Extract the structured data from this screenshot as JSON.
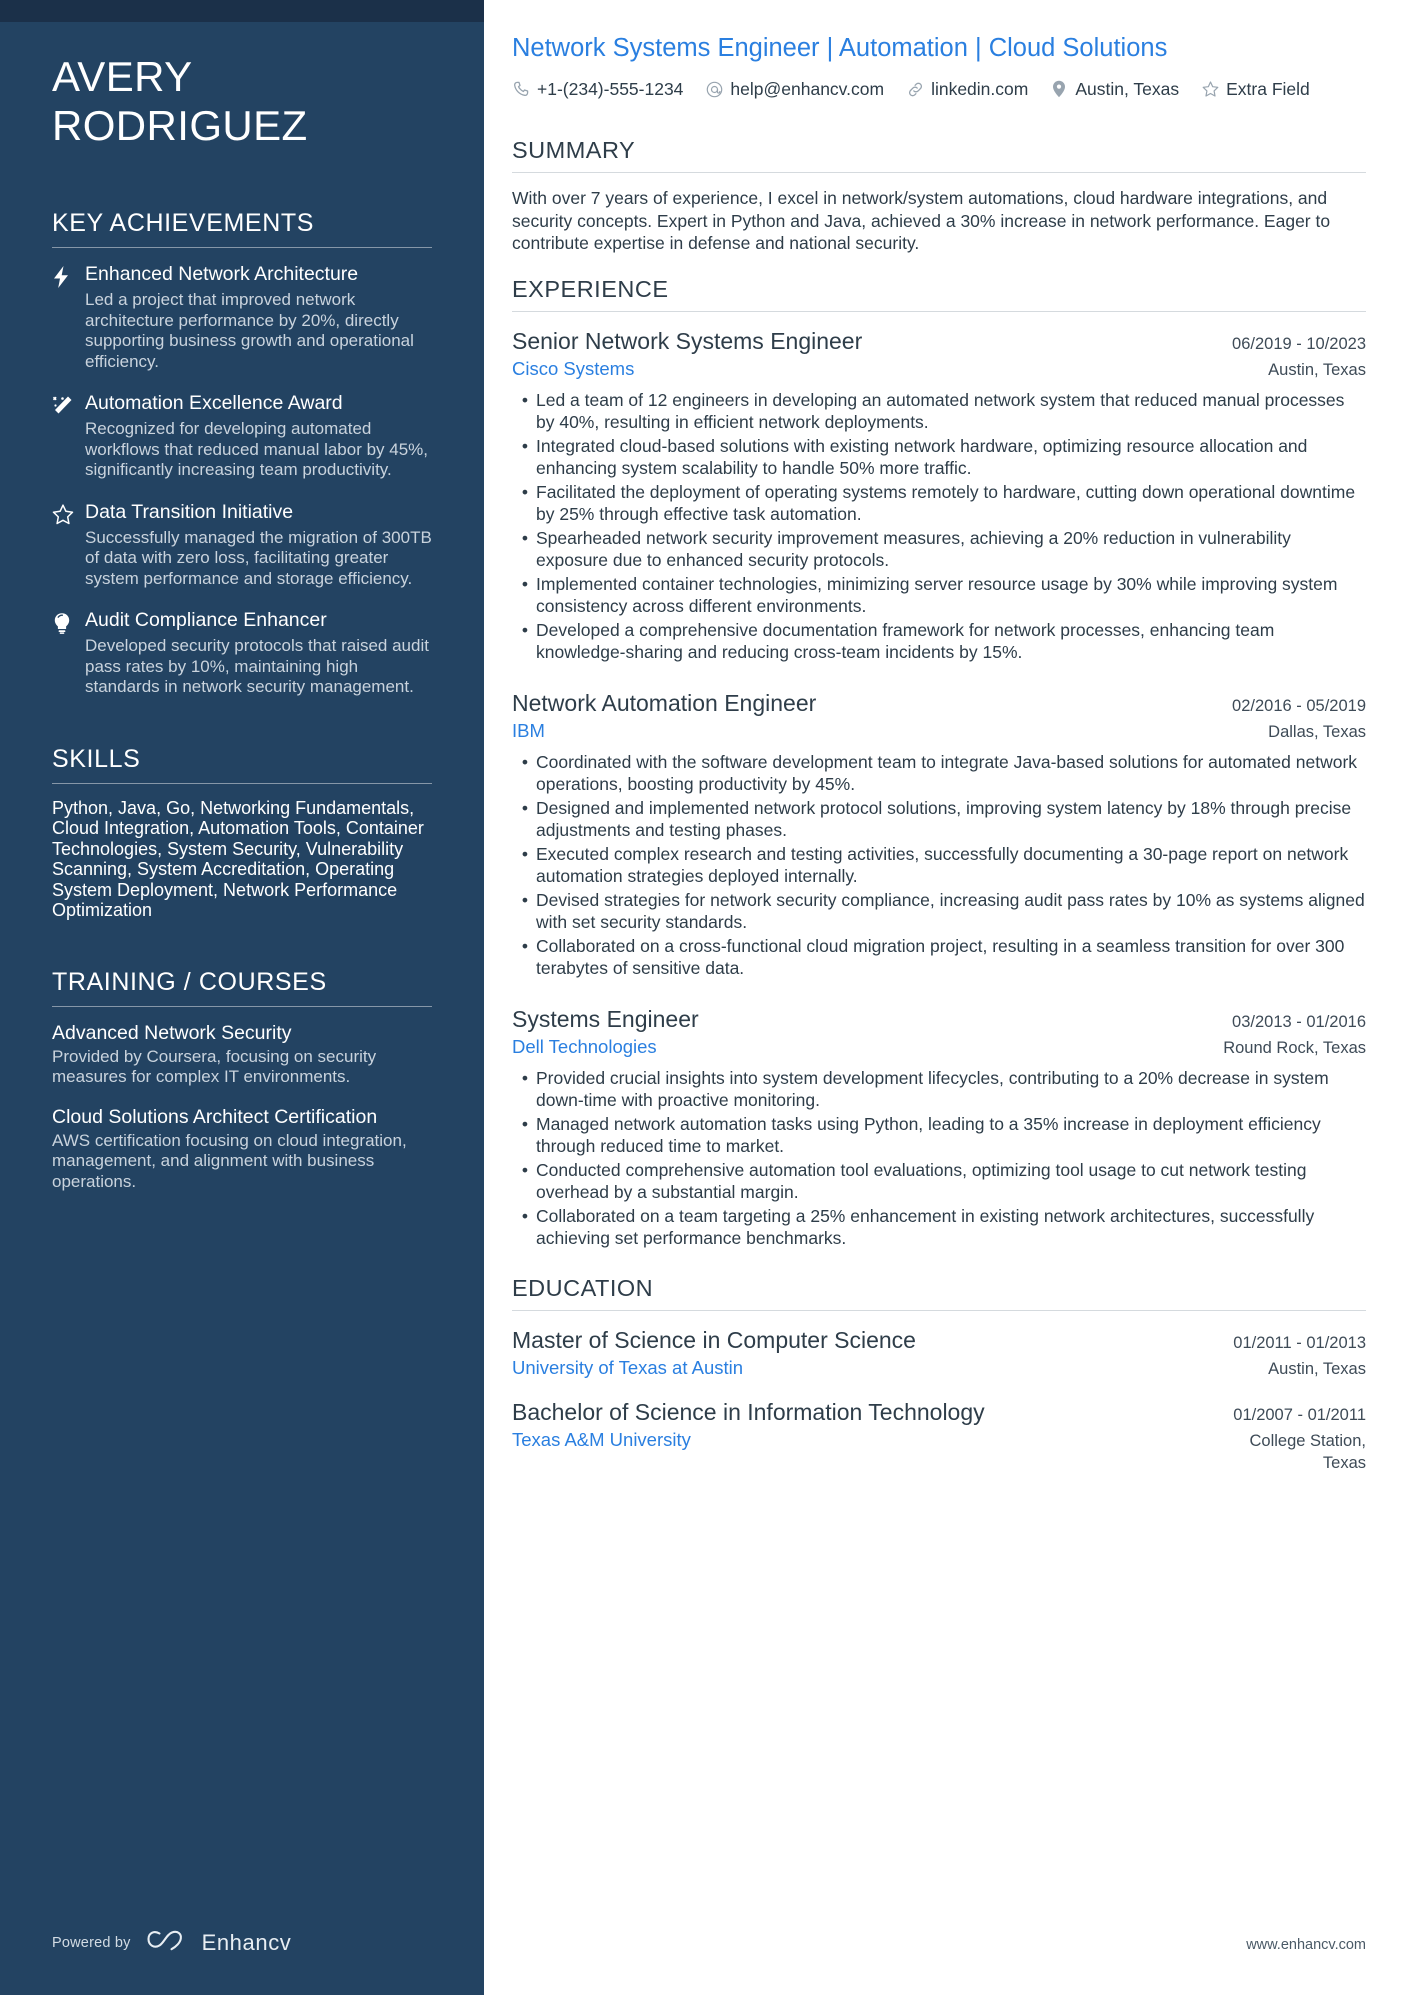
{
  "sidebar": {
    "name_lines": [
      "AVERY",
      "RODRIGUEZ"
    ],
    "achievements_heading": "KEY ACHIEVEMENTS",
    "achievements": [
      {
        "icon": "lightning-bolt-icon",
        "title": "Enhanced Network Architecture",
        "desc": "Led a project that improved network architecture performance by 20%, directly supporting business growth and operational efficiency."
      },
      {
        "icon": "magic-wand-icon",
        "title": "Automation Excellence Award",
        "desc": "Recognized for developing automated workflows that reduced manual labor by 45%, significantly increasing team productivity."
      },
      {
        "icon": "star-outline-icon",
        "title": "Data Transition Initiative",
        "desc": "Successfully managed the migration of 300TB of data with zero loss, facilitating greater system performance and storage efficiency."
      },
      {
        "icon": "lightbulb-icon",
        "title": "Audit Compliance Enhancer",
        "desc": "Developed security protocols that raised audit pass rates by 10%, maintaining high standards in network security management."
      }
    ],
    "skills_heading": "SKILLS",
    "skills_text": "Python, Java, Go, Networking Fundamentals, Cloud Integration, Automation Tools, Container Technologies, System Security, Vulnerability Scanning, System Accreditation, Operating System Deployment, Network Performance Optimization",
    "training_heading": "TRAINING / COURSES",
    "courses": [
      {
        "title": "Advanced Network Security",
        "desc": "Provided by Coursera, focusing on security measures for complex IT environments."
      },
      {
        "title": "Cloud Solutions Architect Certification",
        "desc": "AWS certification focusing on cloud integration, management, and alignment with business operations."
      }
    ],
    "footer": {
      "powered_by": "Powered by",
      "brand": "Enhancv"
    }
  },
  "header": {
    "headline": "Network Systems Engineer | Automation | Cloud Solutions",
    "contacts": [
      {
        "icon": "phone-icon",
        "text": "+1-(234)-555-1234"
      },
      {
        "icon": "at-sign-icon",
        "text": "help@enhancv.com"
      },
      {
        "icon": "link-icon",
        "text": "linkedin.com"
      },
      {
        "icon": "location-pin-icon",
        "text": "Austin, Texas"
      },
      {
        "icon": "star-outline-icon",
        "text": "Extra Field"
      }
    ]
  },
  "summary": {
    "heading": "SUMMARY",
    "text": "With over 7 years of experience, I excel in network/system automations, cloud hardware integrations, and security concepts. Expert in Python and Java, achieved a 30% increase in network performance. Eager to contribute expertise in defense and national security."
  },
  "experience": {
    "heading": "EXPERIENCE",
    "entries": [
      {
        "title": "Senior Network Systems Engineer",
        "company": "Cisco Systems",
        "date": "06/2019 - 10/2023",
        "location": "Austin, Texas",
        "bullets": [
          "Led a team of 12 engineers in developing an automated network system that reduced manual processes by 40%, resulting in efficient network deployments.",
          "Integrated cloud-based solutions with existing network hardware, optimizing resource allocation and enhancing system scalability to handle 50% more traffic.",
          "Facilitated the deployment of operating systems remotely to hardware, cutting down operational downtime by 25% through effective task automation.",
          "Spearheaded network security improvement measures, achieving a 20% reduction in vulnerability exposure due to enhanced security protocols.",
          "Implemented container technologies, minimizing server resource usage by 30% while improving system consistency across different environments.",
          "Developed a comprehensive documentation framework for network processes, enhancing team knowledge-sharing and reducing cross-team incidents by 15%."
        ]
      },
      {
        "title": "Network Automation Engineer",
        "company": "IBM",
        "date": "02/2016 - 05/2019",
        "location": "Dallas, Texas",
        "bullets": [
          "Coordinated with the software development team to integrate Java-based solutions for automated network operations, boosting productivity by 45%.",
          "Designed and implemented network protocol solutions, improving system latency by 18% through precise adjustments and testing phases.",
          "Executed complex research and testing activities, successfully documenting a 30-page report on network automation strategies deployed internally.",
          "Devised strategies for network security compliance, increasing audit pass rates by 10% as systems aligned with set security standards.",
          "Collaborated on a cross-functional cloud migration project, resulting in a seamless transition for over 300 terabytes of sensitive data."
        ]
      },
      {
        "title": "Systems Engineer",
        "company": "Dell Technologies",
        "date": "03/2013 - 01/2016",
        "location": "Round Rock, Texas",
        "bullets": [
          "Provided crucial insights into system development lifecycles, contributing to a 20% decrease in system down-time with proactive monitoring.",
          "Managed network automation tasks using Python, leading to a 35% increase in deployment efficiency through reduced time to market.",
          "Conducted comprehensive automation tool evaluations, optimizing tool usage to cut network testing overhead by a substantial margin.",
          "Collaborated on a team targeting a 25% enhancement in existing network architectures, successfully achieving set performance benchmarks."
        ]
      }
    ]
  },
  "education": {
    "heading": "EDUCATION",
    "entries": [
      {
        "degree": "Master of Science in Computer Science",
        "school": "University of Texas at Austin",
        "date": "01/2011 - 01/2013",
        "location": "Austin, Texas"
      },
      {
        "degree": "Bachelor of Science in Information Technology",
        "school": "Texas A&M University",
        "date": "01/2007 - 01/2011",
        "location": "College Station, Texas"
      }
    ]
  },
  "main_footer": {
    "site": "www.enhancv.com"
  },
  "colors": {
    "sidebar_bg": "#234362",
    "sidebar_top_strip": "#1b3049",
    "accent_blue": "#2a7fe0",
    "body_text": "#2e3d49"
  }
}
